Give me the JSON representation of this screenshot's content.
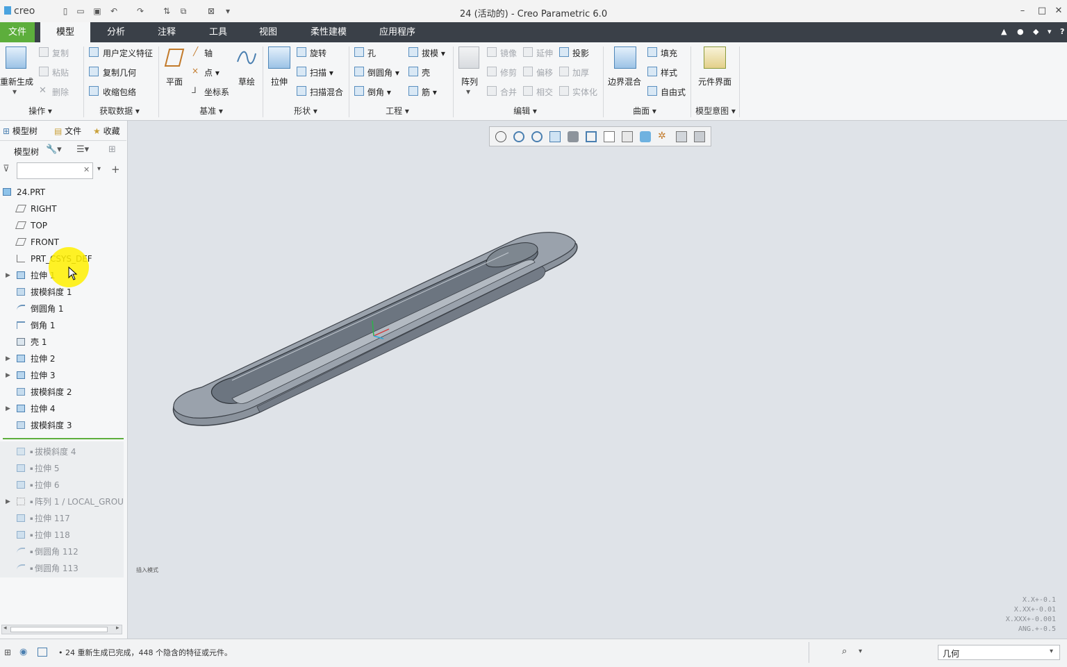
{
  "app": {
    "logo": "creo",
    "window_title": "24 (活动的) - Creo Parametric 6.0"
  },
  "ribbon_tabs": [
    "文件",
    "模型",
    "分析",
    "注释",
    "工具",
    "视图",
    "柔性建模",
    "应用程序"
  ],
  "active_tab": "模型",
  "ribbon": {
    "operations": {
      "regenerate": "重新生成",
      "copy": "复制",
      "paste": "粘贴",
      "delete": "删除",
      "group": "操作"
    },
    "get_data": {
      "udf": "用户定义特征",
      "copy_geom": "复制几何",
      "shrinkwrap": "收缩包络",
      "group": "获取数据"
    },
    "datum": {
      "plane": "平面",
      "axis": "轴",
      "point": "点",
      "csys": "坐标系",
      "sketch": "草绘",
      "group": "基准"
    },
    "shapes": {
      "extrude": "拉伸",
      "revolve": "旋转",
      "sweep": "扫描",
      "swept_blend": "扫描混合",
      "group": "形状"
    },
    "engineering": {
      "hole": "孔",
      "draft": "拔模",
      "round": "倒圆角",
      "shell": "壳",
      "chamfer": "倒角",
      "rib": "筋",
      "group": "工程"
    },
    "editing": {
      "pattern": "阵列",
      "mirror": "镜像",
      "extend": "延伸",
      "project": "投影",
      "trim": "修剪",
      "offset": "偏移",
      "thicken": "加厚",
      "merge": "合并",
      "intersect": "相交",
      "solidify": "实体化",
      "group": "编辑"
    },
    "surfaces": {
      "boundary_blend": "边界混合",
      "fill": "填充",
      "style": "样式",
      "freestyle": "自由式",
      "group": "曲面"
    },
    "model_intent": {
      "component_interface": "元件界面",
      "group": "模型意图"
    }
  },
  "left_panel": {
    "tabs": [
      "模型树",
      "文件",
      "收藏"
    ],
    "tree_header": "模型树",
    "search_placeholder": "",
    "root": "24.PRT",
    "items": [
      {
        "label": "RIGHT",
        "icon": "datum-plane-icon",
        "expand": false,
        "dim": false
      },
      {
        "label": "TOP",
        "icon": "datum-plane-icon",
        "expand": false,
        "dim": false
      },
      {
        "label": "FRONT",
        "icon": "datum-plane-icon",
        "expand": false,
        "dim": false
      },
      {
        "label": "PRT_CSYS_DEF",
        "icon": "csys-icon",
        "expand": false,
        "dim": false
      },
      {
        "label": "拉伸 1",
        "icon": "extrude-icon",
        "expand": true,
        "dim": false
      },
      {
        "label": "拔模斜度 1",
        "icon": "draft-icon",
        "expand": false,
        "dim": false
      },
      {
        "label": "倒圆角 1",
        "icon": "round-icon",
        "expand": false,
        "dim": false
      },
      {
        "label": "倒角 1",
        "icon": "chamfer-icon",
        "expand": false,
        "dim": false
      },
      {
        "label": "壳 1",
        "icon": "shell-icon",
        "expand": false,
        "dim": false
      },
      {
        "label": "拉伸 2",
        "icon": "extrude-icon",
        "expand": true,
        "dim": false
      },
      {
        "label": "拉伸 3",
        "icon": "extrude-icon",
        "expand": true,
        "dim": false
      },
      {
        "label": "拔模斜度 2",
        "icon": "draft-icon",
        "expand": false,
        "dim": false
      },
      {
        "label": "拉伸 4",
        "icon": "extrude-icon",
        "expand": true,
        "dim": false
      },
      {
        "label": "拔模斜度 3",
        "icon": "draft-icon",
        "expand": false,
        "dim": false
      }
    ],
    "suppressed_items": [
      {
        "label": "拔模斜度 4",
        "icon": "draft-icon",
        "expand": false
      },
      {
        "label": "拉伸 5",
        "icon": "extrude-icon",
        "expand": false
      },
      {
        "label": "拉伸 6",
        "icon": "extrude-icon",
        "expand": false
      },
      {
        "label": "阵列 1 / LOCAL_GROU",
        "icon": "pattern-icon",
        "expand": true
      },
      {
        "label": "拉伸 117",
        "icon": "extrude-icon",
        "expand": false
      },
      {
        "label": "拉伸 118",
        "icon": "extrude-icon",
        "expand": false
      },
      {
        "label": "倒圆角 112",
        "icon": "round-icon",
        "expand": false
      },
      {
        "label": "倒圆角 113",
        "icon": "round-icon",
        "expand": false
      }
    ]
  },
  "viewport": {
    "insert_mode_label": "插入模式",
    "tolerance_lines": [
      "X.X+-0.1",
      "X.XX+-0.01",
      "X.XXX+-0.001",
      "ANG.+-0.5"
    ]
  },
  "status_bar": {
    "message": "24 重新生成已完成，448 个隐含的特征或元件。",
    "filter_value": "几何"
  },
  "colors": {
    "file_tab": "#5dae3c",
    "tab_bar": "#3a4048",
    "viewport_bg": "#dfe3e8",
    "part_color": "#7f8792"
  }
}
